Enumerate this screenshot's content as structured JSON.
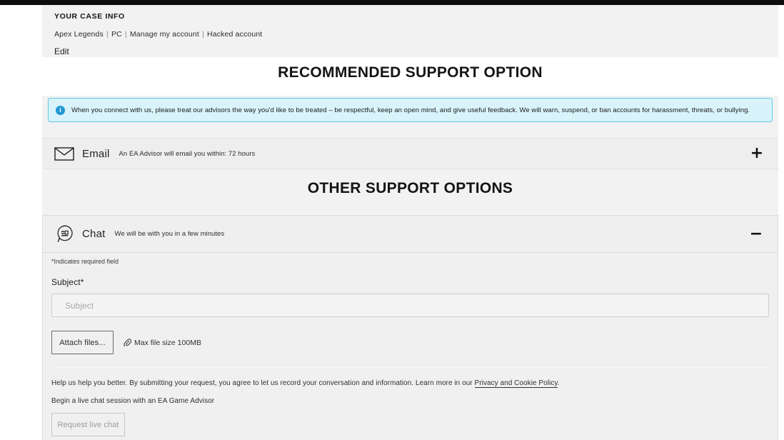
{
  "case_info": {
    "title": "YOUR CASE INFO",
    "crumbs": [
      "Apex Legends",
      "PC",
      "Manage my account",
      "Hacked account"
    ],
    "edit_label": "Edit"
  },
  "headings": {
    "recommended": "RECOMMENDED SUPPORT OPTION",
    "other": "OTHER SUPPORT OPTIONS"
  },
  "notice": {
    "icon": "info-icon",
    "text": "When you connect with us, please treat our advisors the way you'd like to be treated – be respectful, keep an open mind, and give useful feedback. We will warn, suspend, or ban accounts for harassment, threats, or bullying.",
    "background_color": "#d9f3fb",
    "border_color": "#5bc8e8",
    "icon_color": "#2196d6"
  },
  "email_option": {
    "icon": "envelope-icon",
    "label": "Email",
    "subtext": "An EA Advisor will email you within: 72 hours",
    "toggle": "+"
  },
  "chat_option": {
    "icon": "chat-bubble-icon",
    "label": "Chat",
    "subtext": "We will be with you in a few minutes",
    "toggle": "−"
  },
  "chat_form": {
    "required_note": "*Indicates required field",
    "subject_label": "Subject*",
    "subject_placeholder": "Subject",
    "subject_value": "",
    "attach_button": "Attach files...",
    "attach_icon": "paperclip-icon",
    "attach_hint": "Max file size 100MB",
    "legal_prefix": "Help us help you better. By submitting your request, you agree to let us record your conversation and information. Learn more in our ",
    "legal_link": "Privacy and Cookie Policy",
    "legal_suffix": ".",
    "begin_text": "Begin a live chat session with an EA Game Advisor",
    "request_button": "Request live chat"
  }
}
